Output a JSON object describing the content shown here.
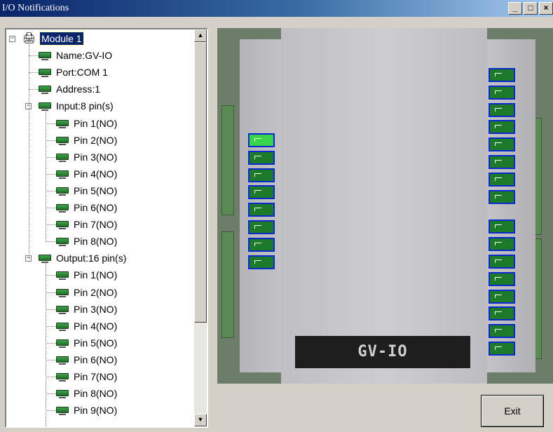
{
  "window": {
    "title": "I/O Notifications",
    "minimize": "_",
    "maximize": "□",
    "close": "×"
  },
  "tree": {
    "module": {
      "label": "Module 1",
      "name": "Name:GV-IO",
      "port": "Port:COM 1",
      "address": "Address:1"
    },
    "input": {
      "label": "Input:8 pin(s)",
      "pins": [
        "Pin 1(NO)",
        "Pin 2(NO)",
        "Pin 3(NO)",
        "Pin 4(NO)",
        "Pin 5(NO)",
        "Pin 6(NO)",
        "Pin 7(NO)",
        "Pin 8(NO)"
      ]
    },
    "output": {
      "label": "Output:16 pin(s)",
      "pins": [
        "Pin 1(NO)",
        "Pin 2(NO)",
        "Pin 3(NO)",
        "Pin 4(NO)",
        "Pin 5(NO)",
        "Pin 6(NO)",
        "Pin 7(NO)",
        "Pin 8(NO)",
        "Pin 9(NO)"
      ]
    }
  },
  "device": {
    "logo": "GV-IO",
    "input_leds": 8,
    "output_leds": 16,
    "active_input_pin": 1
  },
  "buttons": {
    "exit": "Exit"
  },
  "colors": {
    "led_off": "#1c7a2a",
    "led_on": "#39d44a",
    "led_border": "#0a2ad0"
  }
}
